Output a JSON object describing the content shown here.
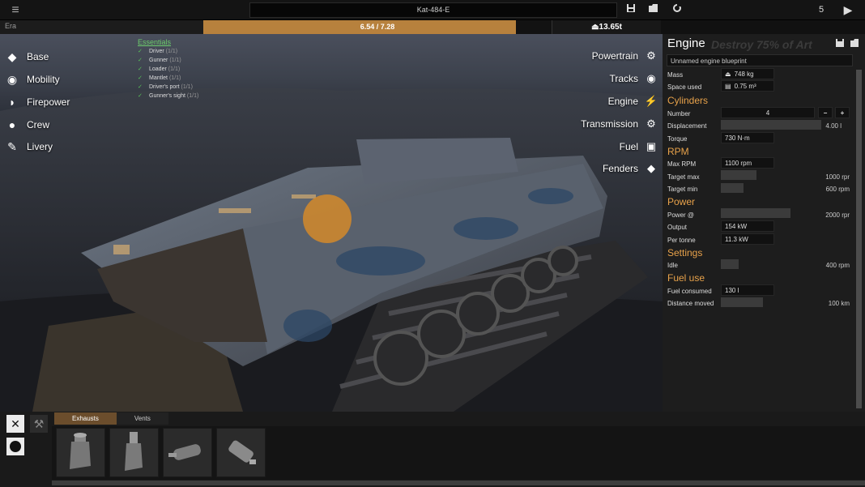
{
  "topbar": {
    "menu_icon": "menu-icon",
    "vehicle_name": "Kat-484-E",
    "save_icon": "save-icon",
    "load_icon": "folder-icon",
    "reset_icon": "refresh-icon",
    "count": "5",
    "play_icon": "play-icon"
  },
  "erabar": {
    "label": "Era",
    "progress_text": "6.54 / 7.28",
    "progress_fraction": 0.898,
    "weight": "13.65t",
    "accent_color": "#b7813d"
  },
  "left_menu": [
    {
      "label": "Base",
      "icon": "cube-icon"
    },
    {
      "label": "Mobility",
      "icon": "wheel-icon"
    },
    {
      "label": "Firepower",
      "icon": "turret-icon"
    },
    {
      "label": "Crew",
      "icon": "person-icon"
    },
    {
      "label": "Livery",
      "icon": "brush-icon"
    }
  ],
  "essentials": {
    "title": "Essentials",
    "items": [
      {
        "name": "Driver",
        "count": "(1/1)"
      },
      {
        "name": "Gunner",
        "count": "(1/1)"
      },
      {
        "name": "Loader",
        "count": "(1/1)"
      },
      {
        "name": "Mantlet",
        "count": "(1/1)"
      },
      {
        "name": "Driver's port",
        "count": "(1/1)"
      },
      {
        "name": "Gunner's sight",
        "count": "(1/1)"
      }
    ]
  },
  "right_menu": [
    {
      "label": "Powertrain",
      "icon": "gear-icon"
    },
    {
      "label": "Tracks",
      "icon": "track-icon"
    },
    {
      "label": "Engine",
      "icon": "engine-icon"
    },
    {
      "label": "Transmission",
      "icon": "transmission-icon"
    },
    {
      "label": "Fuel",
      "icon": "fuel-icon"
    },
    {
      "label": "Fenders",
      "icon": "fender-icon"
    }
  ],
  "panel": {
    "title": "Engine",
    "watermark": "Destroy 75% of Art",
    "blueprint_name": "Unnamed engine blueprint",
    "mass_label": "Mass",
    "mass_value": "748 kg",
    "space_label": "Space used",
    "space_value": "0.75 m³",
    "cylinders_title": "Cylinders",
    "number_label": "Number",
    "number_value": "4",
    "minus_label": "−",
    "plus_label": "+",
    "displacement_label": "Displacement",
    "displacement_value": "4.00 l",
    "torque_label": "Torque",
    "torque_value": "730 N·m",
    "rpm_title": "RPM",
    "max_rpm_label": "Max RPM",
    "max_rpm_value": "1100 rpm",
    "target_max_label": "Target max",
    "target_max_value": "1000 rpr",
    "target_min_label": "Target min",
    "target_min_value": "600 rpm",
    "power_title": "Power",
    "power_at_label": "Power @",
    "power_at_value": "2000 rpr",
    "output_label": "Output",
    "output_value": "154 kW",
    "per_tonne_label": "Per tonne",
    "per_tonne_value": "11.3 kW",
    "settings_title": "Settings",
    "idle_label": "Idle",
    "idle_value": "400 rpm",
    "fuel_title": "Fuel use",
    "fuel_consumed_label": "Fuel consumed",
    "fuel_consumed_value": "130 l",
    "distance_label": "Distance moved",
    "distance_value": "100 km",
    "accent_color": "#e8a24a"
  },
  "bottombar": {
    "tabs": [
      "Exhausts",
      "Vents"
    ],
    "active_tab": "Exhausts",
    "parts": [
      "exhaust-pipe-1",
      "exhaust-pipe-2",
      "exhaust-muffler-1",
      "exhaust-muffler-2"
    ]
  }
}
